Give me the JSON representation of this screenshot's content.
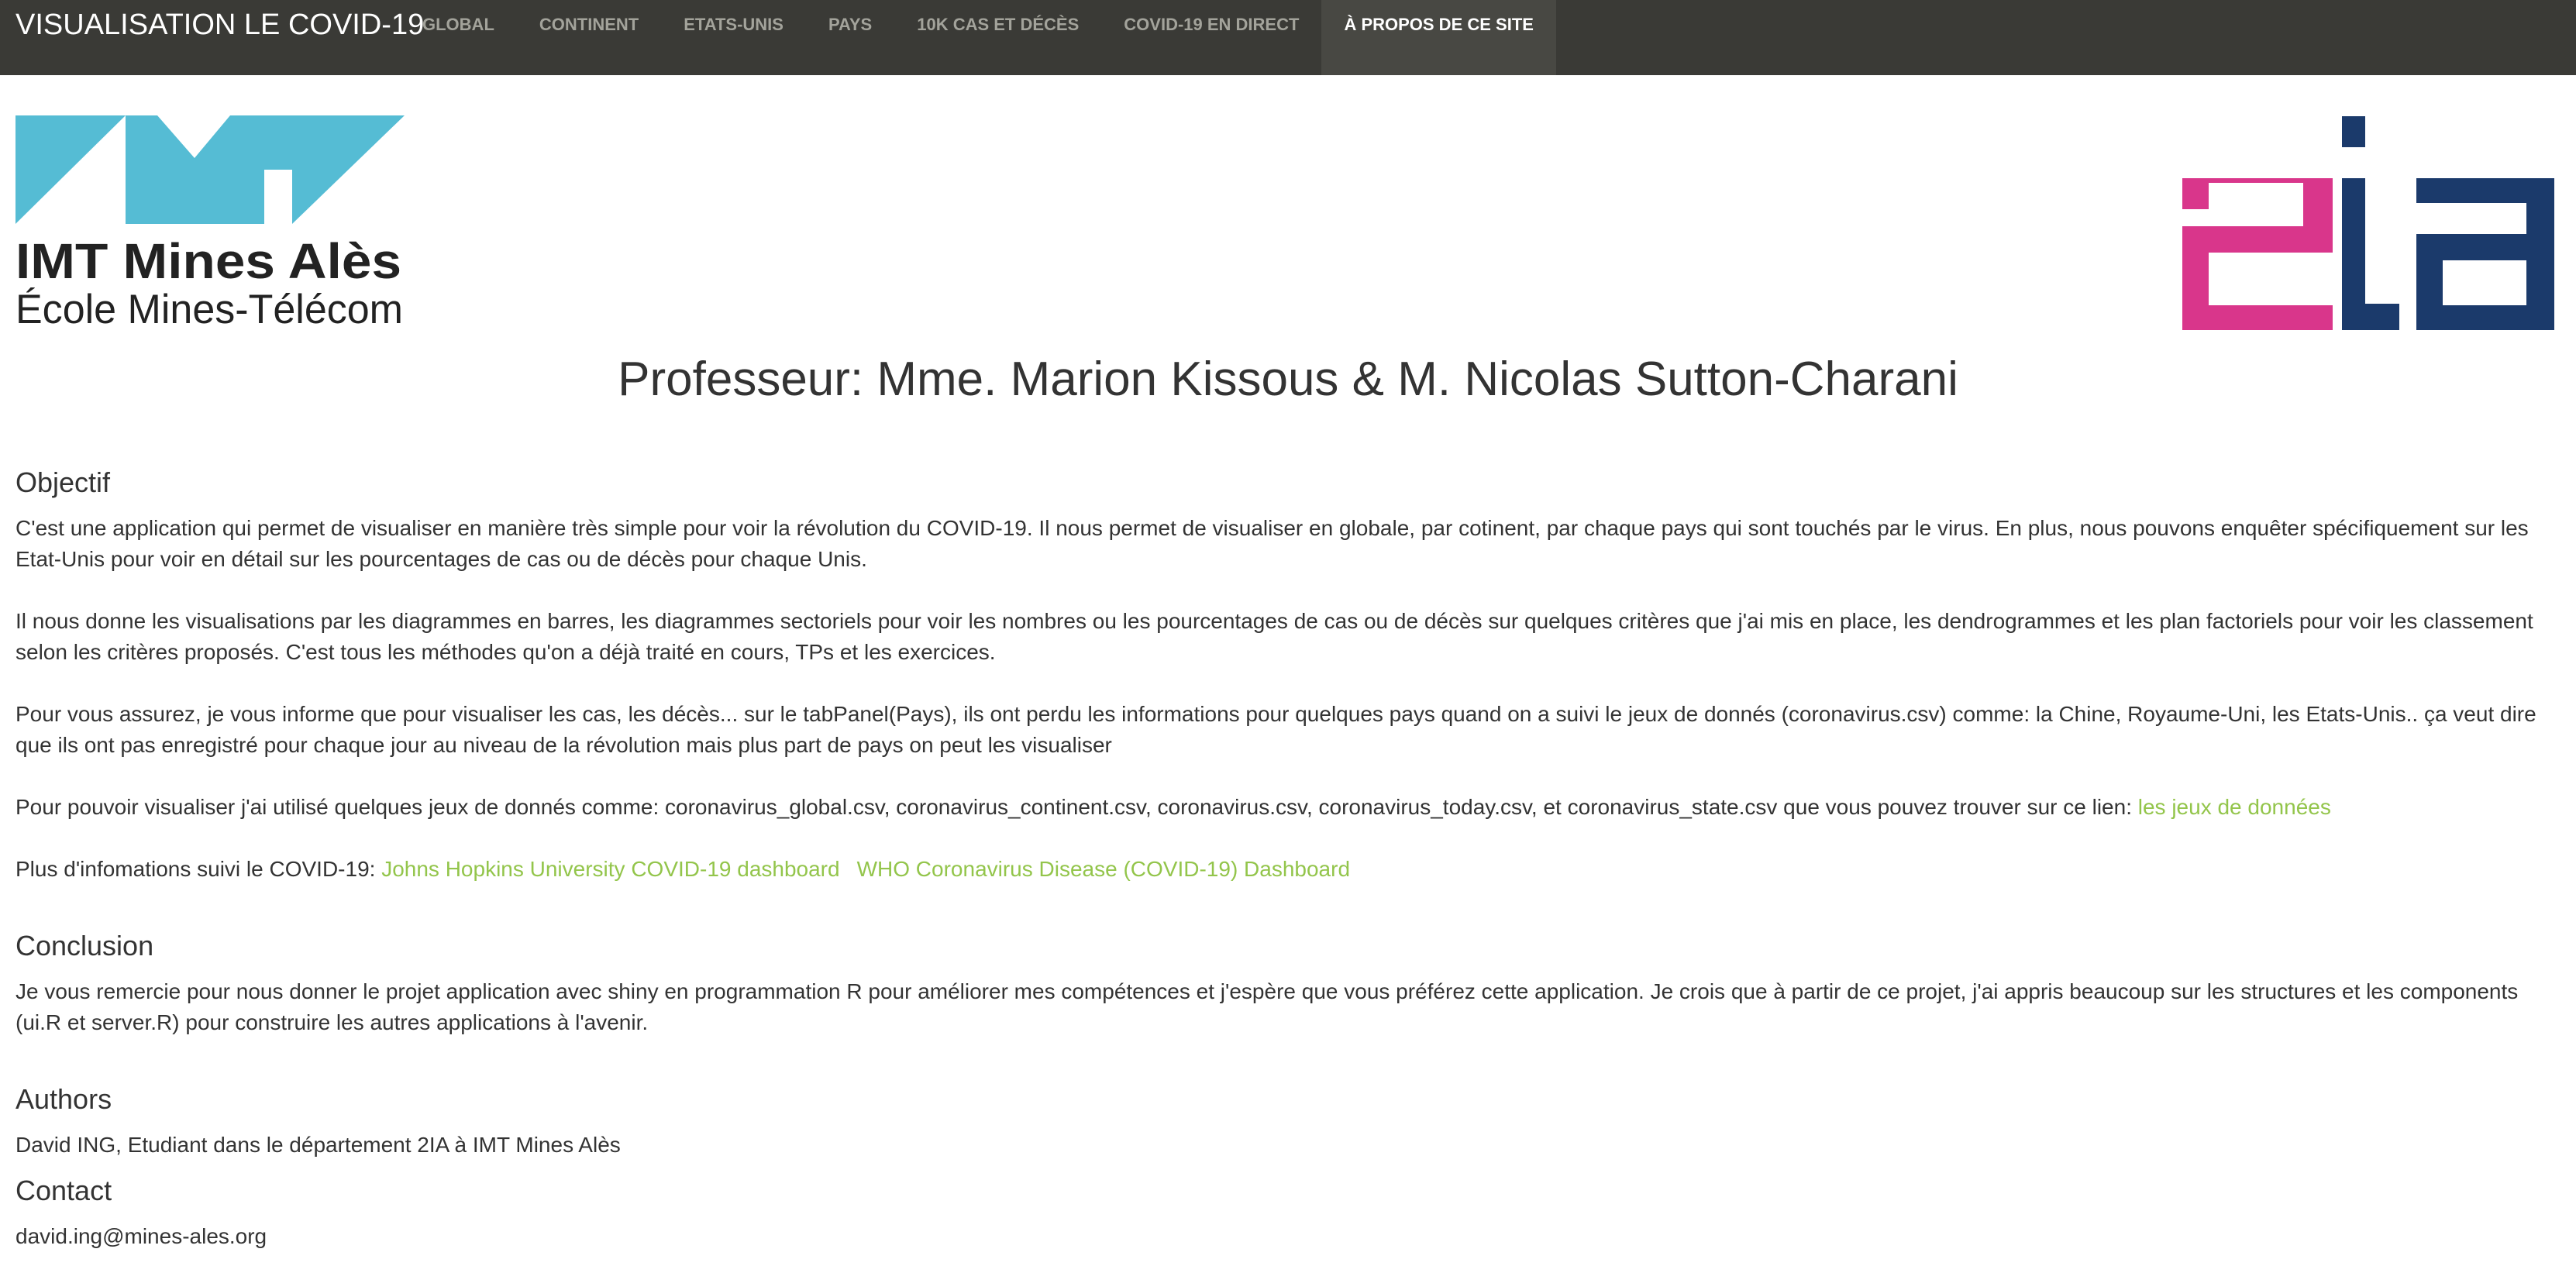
{
  "navbar": {
    "brand": "VISUALISATION LE COVID-19",
    "tabs": [
      {
        "label": "GLOBAL"
      },
      {
        "label": "CONTINENT"
      },
      {
        "label": "ETATS-UNIS"
      },
      {
        "label": "PAYS"
      },
      {
        "label": "10K CAS ET DÉCÈS"
      },
      {
        "label": "COVID-19 EN DIRECT"
      },
      {
        "label": "À PROPOS DE CE SITE",
        "active": true
      }
    ]
  },
  "logos": {
    "imt": {
      "line1": "IMT Mines Alès",
      "line2": "École Mines-Télécom",
      "color": "#55bcd4"
    },
    "two_ia": {
      "text": "2ia",
      "pink": "#d9368b",
      "navy": "#1b3a6b"
    }
  },
  "professor": "Professeur: Mme. Marion Kissous & M. Nicolas Sutton-Charani",
  "objectif": {
    "heading": "Objectif",
    "p1": "C'est une application qui permet de visualiser en manière très simple pour voir la révolution du COVID-19. Il nous permet de visualiser en globale, par cotinent, par chaque pays qui sont touchés par le virus. En plus, nous pouvons enquêter spécifiquement sur les Etat-Unis pour voir en détail sur les pourcentages de cas ou de décès pour chaque Unis.",
    "p2": "Il nous donne les visualisations par les diagrammes en barres, les diagrammes sectoriels pour voir les nombres ou les pourcentages de cas ou de décès sur quelques critères que j'ai mis en place, les dendrogrammes et les plan factoriels pour voir les classement selon les critères proposés. C'est tous les méthodes qu'on a déjà traité en cours, TPs et les exercices.",
    "p3": "Pour vous assurez, je vous informe que pour visualiser les cas, les décès... sur le tabPanel(Pays), ils ont perdu les informations pour quelques pays quand on a suivi le jeux de donnés (coronavirus.csv) comme: la Chine, Royaume-Uni, les Etats-Unis.. ça veut dire que ils ont pas enregistré pour chaque jour au niveau de la révolution mais plus part de pays on peut les visualiser",
    "p4_text": "Pour pouvoir visualiser j'ai utilisé quelques jeux de donnés comme: coronavirus_global.csv, coronavirus_continent.csv, coronavirus.csv, coronavirus_today.csv, et coronavirus_state.csv que vous pouvez trouver sur ce lien: ",
    "p4_link": "les jeux de données",
    "p5_text": "Plus d'infomations suivi le COVID-19: ",
    "p5_link1": "Johns Hopkins University COVID-19 dashboard",
    "p5_link2": "WHO Coronavirus Disease (COVID-19) Dashboard"
  },
  "conclusion": {
    "heading": "Conclusion",
    "text": "Je vous remercie pour nous donner le projet application avec shiny en programmation R pour améliorer mes compétences et j'espère que vous préférez cette application. Je crois que à partir de ce projet, j'ai appris beaucoup sur les structures et les components (ui.R et server.R) pour construire les autres applications à l'avenir."
  },
  "authors": {
    "heading": "Authors",
    "text": "David ING, Etudiant dans le département 2IA à IMT Mines Alès"
  },
  "contact": {
    "heading": "Contact",
    "email": "david.ing@mines-ales.org"
  },
  "colors": {
    "navbar_bg": "#3a3a36",
    "navbar_active_bg": "#484843",
    "nav_text": "#a3a39b",
    "link": "#93c54b",
    "text": "#333333"
  }
}
